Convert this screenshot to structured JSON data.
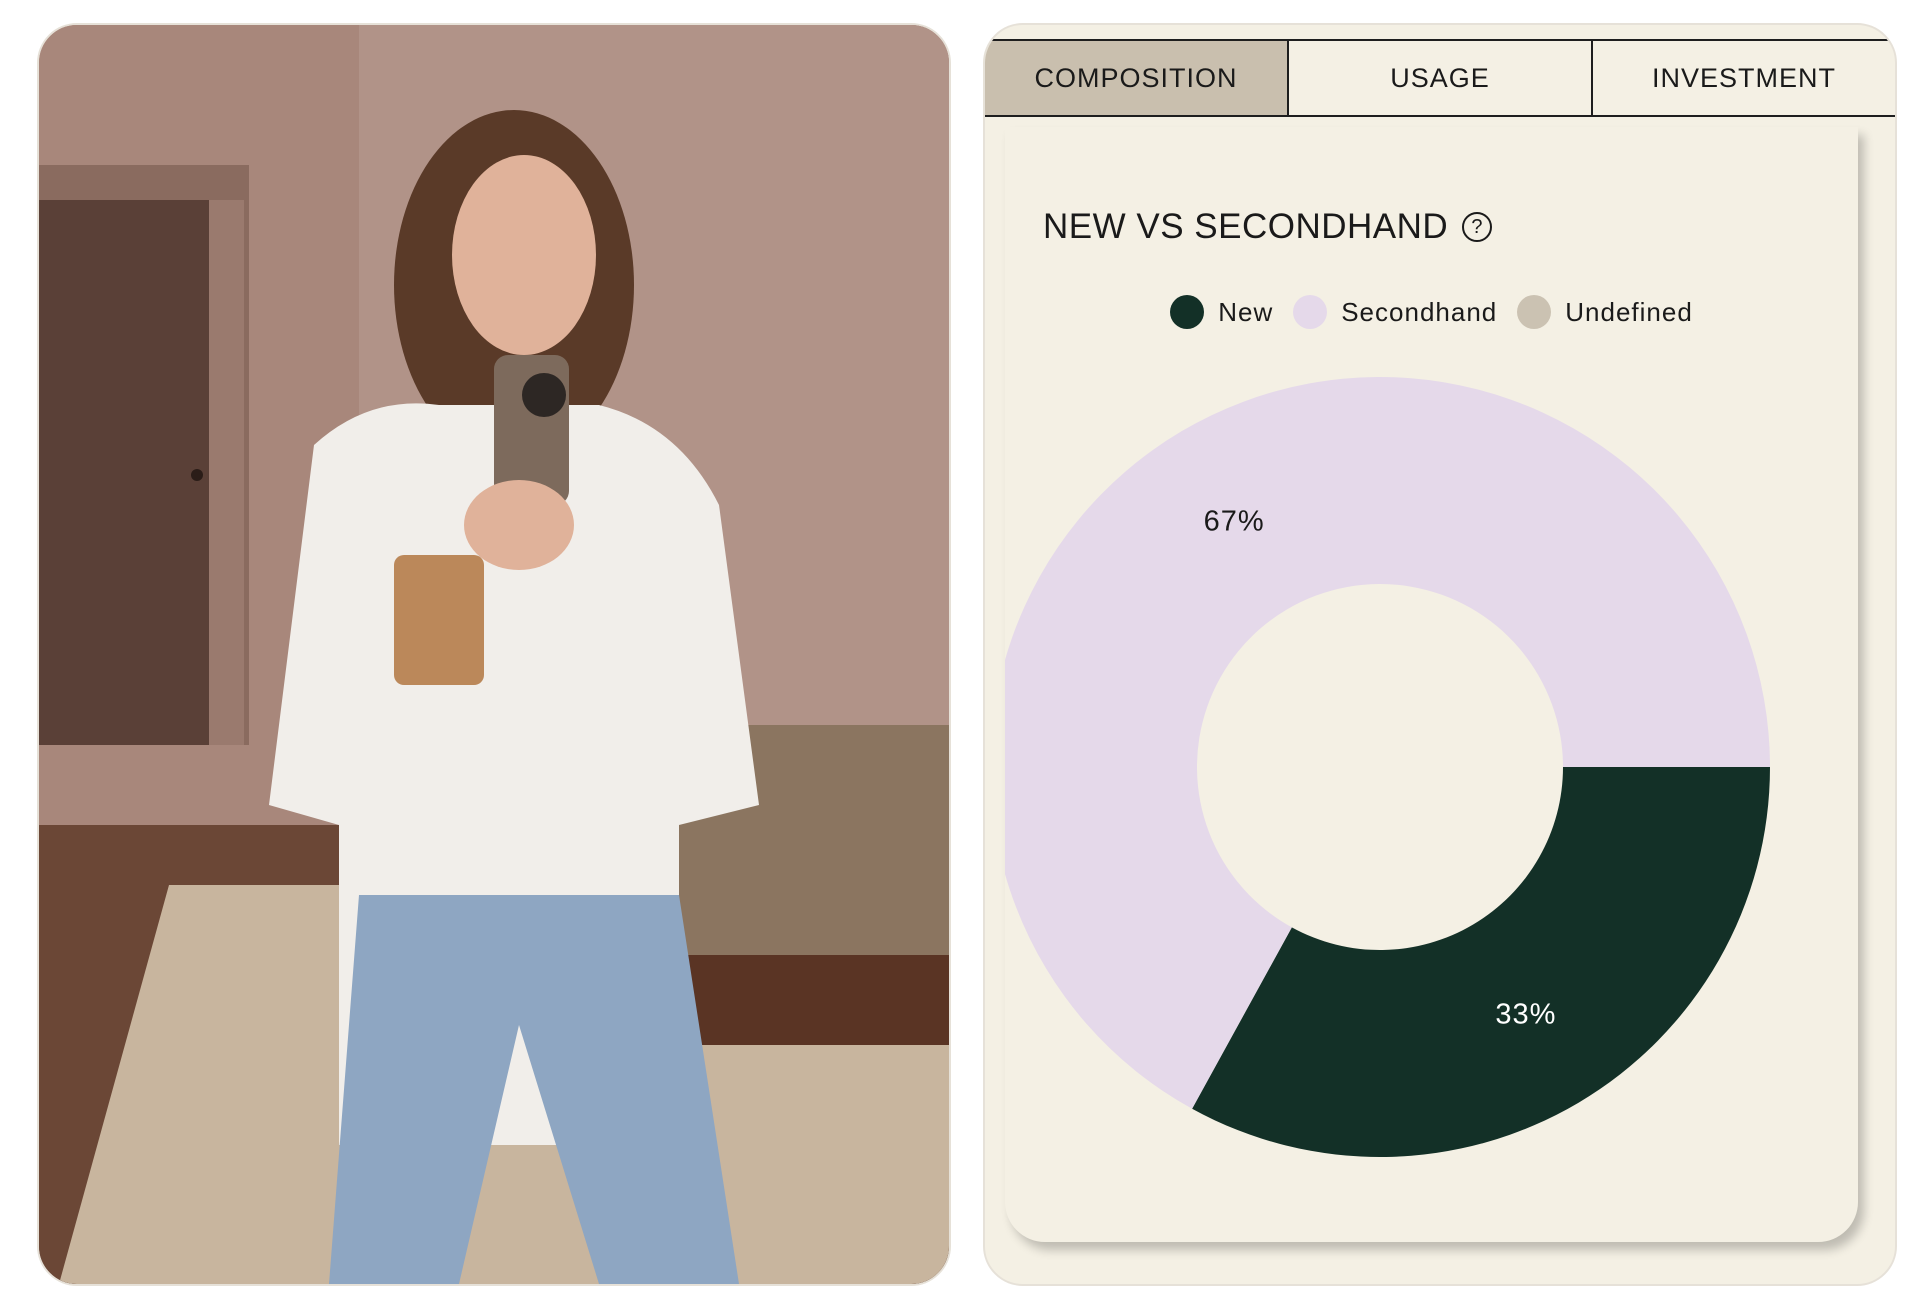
{
  "tabs": [
    {
      "label": "COMPOSITION",
      "active": true
    },
    {
      "label": "USAGE",
      "active": false
    },
    {
      "label": "INVESTMENT",
      "active": false
    }
  ],
  "card": {
    "title": "NEW VS SECONDHAND",
    "help_icon": "question-circle-icon",
    "help_glyph": "?"
  },
  "photo": {
    "description_icon": "photo-image"
  },
  "colors": {
    "new": "#133027",
    "secondhand": "#e5d9ea",
    "undefined": "#cbc2b2",
    "panel_bg": "#f4f0e4",
    "active_tab": "#c9bfae"
  },
  "chart_data": {
    "type": "pie",
    "title": "NEW VS SECONDHAND",
    "legend_position": "top-center",
    "categories": [
      "New",
      "Secondhand",
      "Undefined"
    ],
    "values": [
      33,
      67,
      0
    ],
    "labels": [
      "33%",
      "67%",
      ""
    ],
    "colors": [
      "#133027",
      "#e5d9ea",
      "#cbc2b2"
    ]
  }
}
